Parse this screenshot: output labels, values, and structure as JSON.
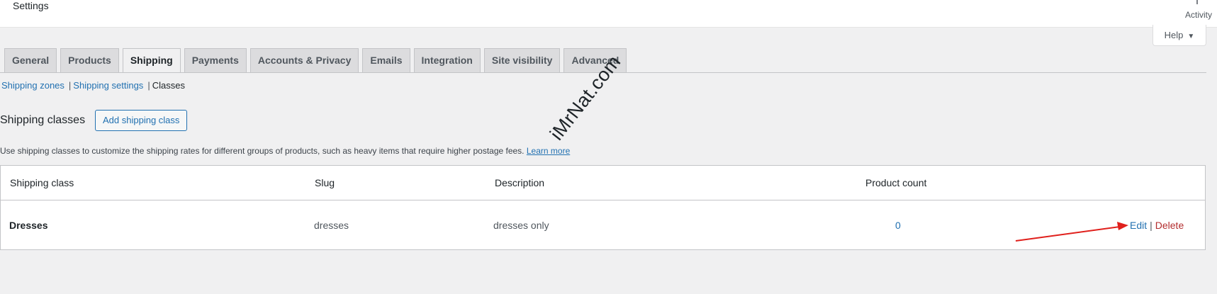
{
  "header": {
    "title": "Settings",
    "activity_label": "Activity",
    "help_label": "Help",
    "help_caret": "▼"
  },
  "tabs": [
    {
      "label": "General"
    },
    {
      "label": "Products"
    },
    {
      "label": "Shipping"
    },
    {
      "label": "Payments"
    },
    {
      "label": "Accounts & Privacy"
    },
    {
      "label": "Emails"
    },
    {
      "label": "Integration"
    },
    {
      "label": "Site visibility"
    },
    {
      "label": "Advanced"
    }
  ],
  "active_tab": "Shipping",
  "subnav": {
    "zones": "Shipping zones",
    "settings": "Shipping settings",
    "classes": "Classes",
    "separator": "|"
  },
  "section": {
    "heading": "Shipping classes",
    "add_button": "Add shipping class",
    "description": "Use shipping classes to customize the shipping rates for different groups of products, such as heavy items that require higher postage fees.",
    "learn_more": "Learn more"
  },
  "table": {
    "columns": [
      "Shipping class",
      "Slug",
      "Description",
      "Product count"
    ],
    "rows": [
      {
        "name": "Dresses",
        "slug": "dresses",
        "description": "dresses only",
        "count": "0",
        "edit": "Edit",
        "separator": "|",
        "delete": "Delete"
      }
    ]
  },
  "watermark": "iMrNat.com",
  "colors": {
    "link": "#2271b1",
    "delete": "#b32d2e",
    "arrow": "#e0201c"
  }
}
